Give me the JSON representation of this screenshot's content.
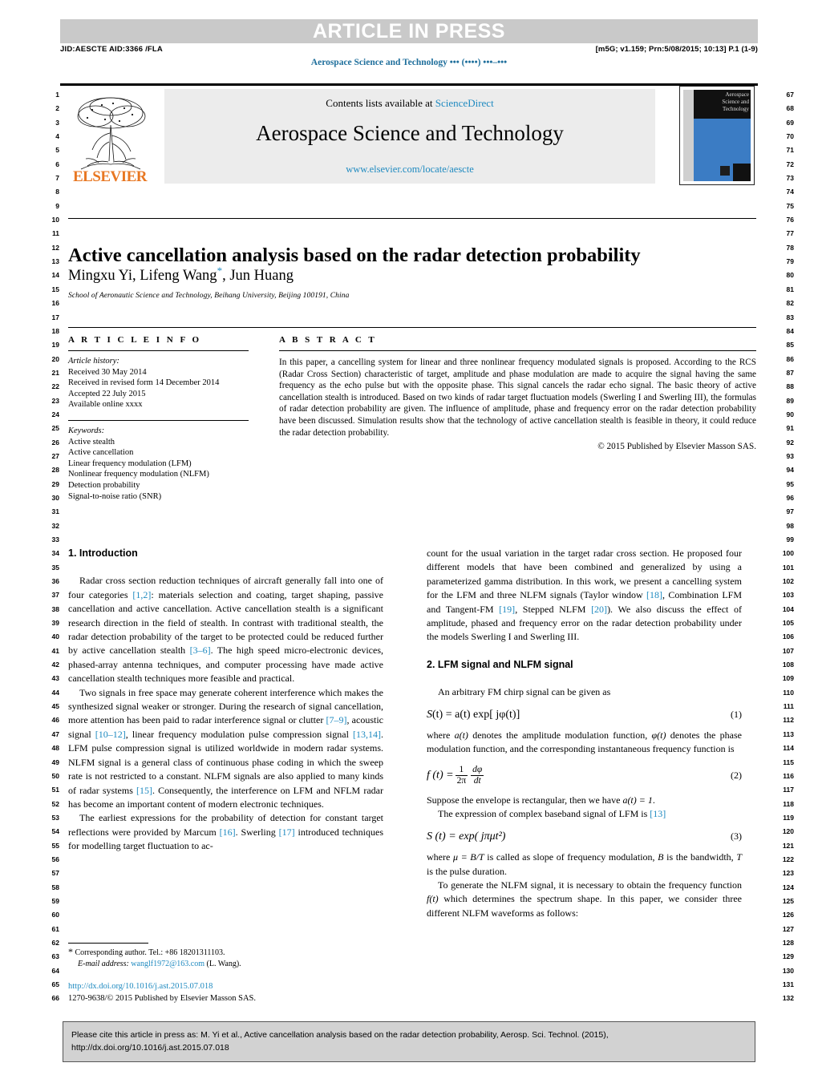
{
  "banner": {
    "article_in_press": "ARTICLE IN PRESS"
  },
  "runhead": {
    "jid": "JID:AESCTE    AID:3366 /FLA",
    "prn": "[m5G; v1.159; Prn:5/08/2015; 10:13] P.1 (1-9)",
    "journal_running": "Aerospace Science and Technology ••• (••••) •••–•••"
  },
  "masthead": {
    "contents_prefix": "Contents lists available at ",
    "sciencedirect": "ScienceDirect",
    "journal_title": "Aerospace Science and Technology",
    "journal_url": "www.elsevier.com/locate/aescte",
    "publisher": "ELSEVIER",
    "cover_title": "Aerospace Science and Technology"
  },
  "title": "Active cancellation analysis based on the radar detection probability",
  "authors_pre": "Mingxu Yi, Lifeng Wang",
  "authors_post": ", Jun Huang",
  "affiliation": "School of Aeronautic Science and Technology, Beihang University, Beijing 100191, China",
  "info": {
    "heading": "A R T I C L E    I N F O",
    "history_label": "Article history:",
    "history": [
      "Received 30 May 2014",
      "Received in revised form 14 December 2014",
      "Accepted 22 July 2015",
      "Available online xxxx"
    ],
    "keywords_label": "Keywords:",
    "keywords": [
      "Active stealth",
      "Active cancellation",
      "Linear frequency modulation (LFM)",
      "Nonlinear frequency modulation (NLFM)",
      "Detection probability",
      "Signal-to-noise ratio (SNR)"
    ]
  },
  "abstract": {
    "heading": "A B S T R A C T",
    "text": "In this paper, a cancelling system for linear and three nonlinear frequency modulated signals is proposed. According to the RCS (Radar Cross Section) characteristic of target, amplitude and phase modulation are made to acquire the signal having the same frequency as the echo pulse but with the opposite phase. This signal cancels the radar echo signal. The basic theory of active cancellation stealth is introduced. Based on two kinds of radar target fluctuation models (Swerling I and Swerling III), the formulas of radar detection probability are given. The influence of amplitude, phase and frequency error on the radar detection probability have been discussed. Simulation results show that the technology of active cancellation stealth is feasible in theory, it could reduce the radar detection probability.",
    "copyright": "© 2015 Published by Elsevier Masson SAS."
  },
  "sections": {
    "intro_heading": "1. Introduction",
    "lfm_heading": "2. LFM signal and NLFM signal"
  },
  "body": {
    "p1_a": "Radar cross section reduction techniques of aircraft generally fall into one of four categories ",
    "p1_r1": "[1,2]",
    "p1_b": ": materials selection and coating, target shaping, passive cancellation and active cancellation. Active cancellation stealth is a significant research direction in the field of stealth. In contrast with traditional stealth, the radar detection probability of the target to be protected could be reduced further by active cancellation stealth ",
    "p1_r2": "[3–6]",
    "p1_c": ". The high speed micro-electronic devices, phased-array antenna techniques, and computer processing have made active cancellation stealth techniques more feasible and practical.",
    "p2_a": "Two signals in free space may generate coherent interference which makes the synthesized signal weaker or stronger. During the research of signal cancellation, more attention has been paid to radar interference signal or clutter ",
    "p2_r1": "[7–9]",
    "p2_b": ", acoustic signal ",
    "p2_r2": "[10–12]",
    "p2_c": ", linear frequency modulation pulse compression signal ",
    "p2_r3": "[13,14]",
    "p2_d": ". LFM pulse compression signal is utilized worldwide in modern radar systems. NLFM signal is a general class of continuous phase coding in which the sweep rate is not restricted to a constant. NLFM signals are also applied to many kinds of radar systems ",
    "p2_r4": "[15]",
    "p2_e": ". Consequently, the interference on LFM and NFLM radar has become an important content of modern electronic techniques.",
    "p3_a": "The earliest expressions for the probability of detection for constant target reflections were provided by Marcum ",
    "p3_r1": "[16]",
    "p3_b": ". Swerling ",
    "p3_r2": "[17]",
    "p3_c": " introduced techniques for modelling target fluctuation to ac-",
    "p4_a": "count for the usual variation in the target radar cross section. He proposed four different models that have been combined and generalized by using a parameterized gamma distribution. In this work, we present a cancelling system for the LFM and three NLFM signals (Taylor window ",
    "p4_r1": "[18]",
    "p4_b": ", Combination LFM and Tangent-FM ",
    "p4_r2": "[19]",
    "p4_c": ", Stepped NLFM ",
    "p4_r3": "[20]",
    "p4_d": "). We also discuss the effect of amplitude, phased and frequency error on the radar detection probability under the models Swerling I and Swerling III.",
    "p5": "An arbitrary FM chirp signal can be given as",
    "p6_a": "where ",
    "p6_i1": "a(t)",
    "p6_b": " denotes the amplitude modulation function, ",
    "p6_i2": "φ(t)",
    "p6_c": " denotes the phase modulation function, and the corresponding instantaneous frequency function is",
    "p7_a": "Suppose the envelope is rectangular, then we have ",
    "p7_i1": "a(t) = 1",
    "p7_b": ".",
    "p8_a": "The expression of complex baseband signal of LFM is ",
    "p8_r1": "[13]",
    "p9_a": "where ",
    "p9_i1": "μ = B/T",
    "p9_b": " is called as slope of frequency modulation, ",
    "p9_i2": "B",
    "p9_c": " is the bandwidth, ",
    "p9_i3": "T",
    "p9_d": " is the pulse duration.",
    "p10_a": "To generate the NLFM signal, it is necessary to obtain the frequency function ",
    "p10_i1": "f(t)",
    "p10_b": " which determines the spectrum shape. In this paper, we consider three different NLFM waveforms as follows:"
  },
  "equations": {
    "eq1_lhs": "S",
    "eq1_body": "(t) = a(t) exp[ jφ(t)]",
    "eq1_num": "(1)",
    "eq2_num": "(2)",
    "eq2_lhs": "f (t) =",
    "eq2_num_frac": "1",
    "eq2_den_frac": "2π",
    "eq2_num_frac2": "dφ",
    "eq2_den_frac2": "dt",
    "eq3_body": "S (t) = exp( jπμt²)",
    "eq3_num": "(3)"
  },
  "footnote": {
    "marker": "*",
    "corresponding": "Corresponding author. Tel.: +86 18201311103.",
    "email_label": "E-mail address:",
    "email": "wanglf1972@163.com",
    "email_suffix": " (L. Wang)."
  },
  "footer": {
    "doi": "http://dx.doi.org/10.1016/j.ast.2015.07.018",
    "issn_line": "1270-9638/© 2015 Published by Elsevier Masson SAS."
  },
  "citation_box": {
    "line1": "Please cite this article in press as: M. Yi et al., Active cancellation analysis based on the radar detection probability, Aerosp. Sci. Technol. (2015),",
    "line2": "http://dx.doi.org/10.1016/j.ast.2015.07.018"
  },
  "line_numbers": {
    "left_start": 1,
    "left_end": 66,
    "right_start": 67,
    "right_end": 132
  },
  "colors": {
    "link": "#1f8ac0",
    "elsevier_orange": "#E87722",
    "banner_grey": "#c9c9c9",
    "mast_grey": "#ececec",
    "cite_grey": "#d2d2d2"
  }
}
